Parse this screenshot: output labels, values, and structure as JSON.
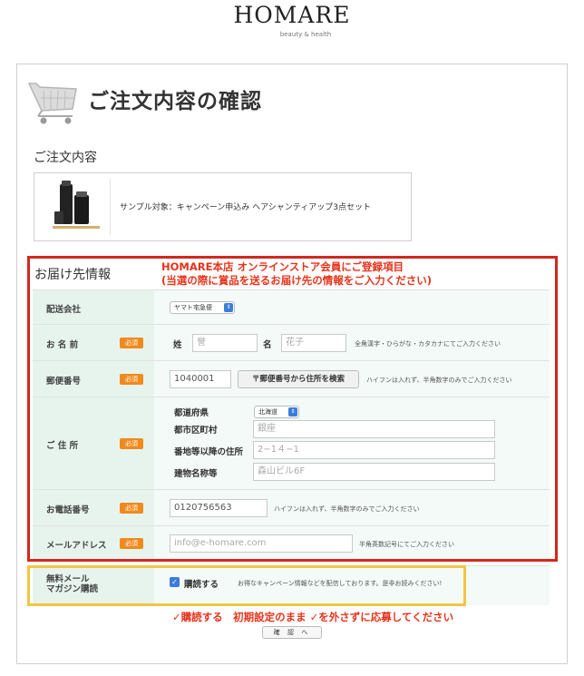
{
  "brand": {
    "name": "HOMARE",
    "tagline": "beauty & health"
  },
  "page": {
    "title": "ご注文内容の確認"
  },
  "order": {
    "section_title": "ご注文内容",
    "product_name": "サンプル対象：キャンペーン申込み ヘアシャンティアップ3点セット"
  },
  "delivery": {
    "section_label": "お届け先情報",
    "notice_line1": "HOMARE本店 オンラインストア会員にご登録項目",
    "notice_line2": "(当選の際に賞品を送るお届け先の情報をご入力ください)"
  },
  "form": {
    "required_badge": "必須",
    "carrier": {
      "label": "配送会社",
      "value": "ヤマト宅急便"
    },
    "name": {
      "label": "お 名 前",
      "last_label": "姓",
      "last_placeholder": "誉",
      "first_label": "名",
      "first_placeholder": "花子",
      "hint": "全角漢字・ひらがな・カタカナにてご入力ください"
    },
    "zip": {
      "label": "郵便番号",
      "value": "1040001",
      "search_button": "〒郵便番号から住所を検索",
      "hint": "ハイフンは入れず、半角数字のみでご入力ください"
    },
    "address": {
      "label": "ご 住 所",
      "pref_label": "都道府県",
      "pref_value": "北海道",
      "city_label": "都市区町村",
      "city_placeholder": "銀座",
      "street_label": "番地等以降の住所",
      "street_placeholder": "2−1４−1",
      "building_label": "建物名称等",
      "building_placeholder": "森山ビル6F"
    },
    "phone": {
      "label": "お電話番号",
      "value": "0120756563",
      "hint": "ハイフンは入れず、半角数字のみでご入力ください"
    },
    "email": {
      "label": "メールアドレス",
      "placeholder": "info@e-homare.com",
      "hint": "半角英数記号にてご入力ください"
    },
    "newsletter": {
      "label_line1": "無料メール",
      "label_line2": "マガジン購読",
      "checkbox_label": "購読する",
      "description": "お得なキャンペーン情報などを配信しております。是非お読みください!"
    }
  },
  "footer": {
    "instruction": "✓購読する　初期設定のまま ✓を外さずに応募してください",
    "confirm_button": "確 認 へ"
  }
}
